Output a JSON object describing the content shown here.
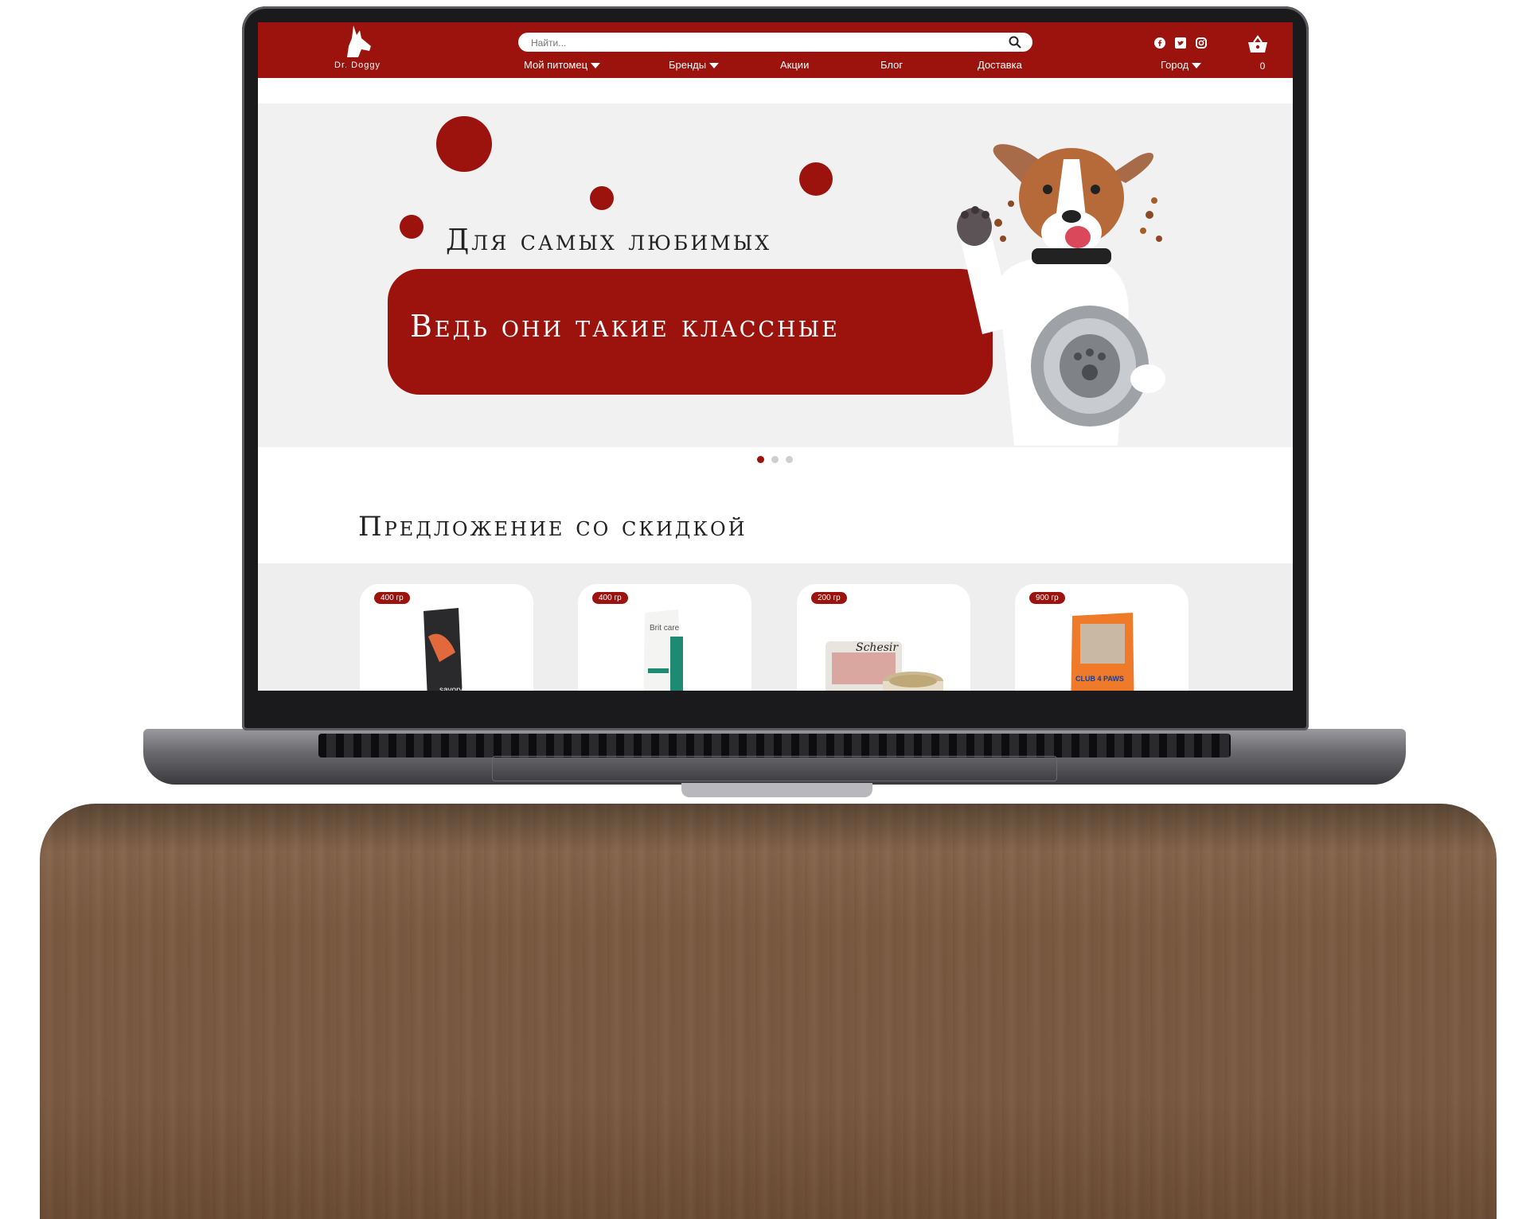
{
  "site": {
    "brand": "Dr. Doggy",
    "colors": {
      "accent": "#9b130c",
      "hero_bg": "#f1f1f1",
      "products_bg": "#eeeeee"
    }
  },
  "header": {
    "search_placeholder": "Найти...",
    "nav": [
      {
        "label": "Мой питомец",
        "dropdown": true
      },
      {
        "label": "Бренды",
        "dropdown": true
      },
      {
        "label": "Акции",
        "dropdown": false
      },
      {
        "label": "Блог",
        "dropdown": false
      },
      {
        "label": "Доставка",
        "dropdown": false
      }
    ],
    "city_label": "Город",
    "social_icons": [
      "facebook-icon",
      "twitter-icon",
      "instagram-icon"
    ],
    "cart_count": "0"
  },
  "hero": {
    "title": "Для самых любимых",
    "subtitle": "Ведь они такие классные",
    "slides": 3,
    "active_slide": 1
  },
  "offers": {
    "title": "Предложение со скидкой",
    "products": [
      {
        "weight": "400 гр",
        "name_on_pack": "savory"
      },
      {
        "weight": "400 гр",
        "name_on_pack": "Brit care"
      },
      {
        "weight": "200 гр",
        "name_on_pack": "Schesir"
      },
      {
        "weight": "900 гр",
        "name_on_pack": "CLUB 4 PAWS"
      }
    ]
  }
}
